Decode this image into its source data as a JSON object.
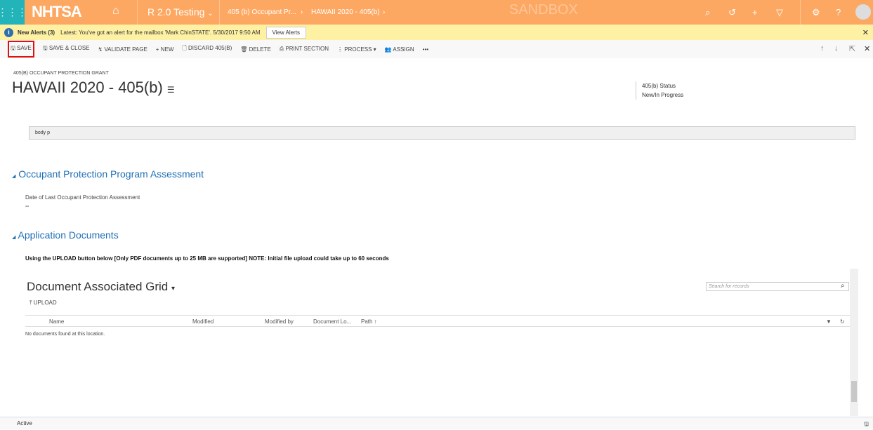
{
  "nav": {
    "logo": "NHTSA",
    "app": "R 2.0 Testing",
    "crumb1": "405 (b) Occupant Pr...",
    "crumb2": "HAWAII 2020 - 405(b)",
    "env": "SANDBOX"
  },
  "alert": {
    "title": "New Alerts (3)",
    "text": "Latest: You've got an alert for the mailbox 'Mark ChinSTATE'. 5/30/2017 9:50 AM",
    "button": "View Alerts"
  },
  "toolbar": {
    "save": "SAVE",
    "save_close": "SAVE & CLOSE",
    "validate": "VALIDATE PAGE",
    "new": "NEW",
    "discard": "DISCARD 405(B)",
    "delete": "DELETE",
    "print": "PRINT SECTION",
    "process": "PROCESS",
    "assign": "ASSIGN",
    "more": "•••"
  },
  "header": {
    "entity": "405(B) OCCUPANT PROTECTION GRANT",
    "title": "HAWAII 2020 - 405(b)",
    "status_label": "405(b) Status",
    "status_value": "New/In Progress"
  },
  "editor": {
    "path": "body  p"
  },
  "section1": {
    "title": "Occupant Protection Program Assessment",
    "field_label": "Date of Last Occupant Protection Assessment",
    "field_value": "--"
  },
  "section2": {
    "title": "Application Documents",
    "note": "Using the UPLOAD button below [Only PDF documents up to 25 MB are supported] NOTE: Initial file upload could take up to 60 seconds"
  },
  "grid": {
    "title": "Document Associated Grid",
    "search_placeholder": "Search for records",
    "upload": "UPLOAD",
    "columns": [
      "Name",
      "Modified",
      "Modified by",
      "Document Lo...",
      "Path ↑"
    ],
    "empty": "No documents found at this location."
  },
  "footer": {
    "status": "Active"
  }
}
